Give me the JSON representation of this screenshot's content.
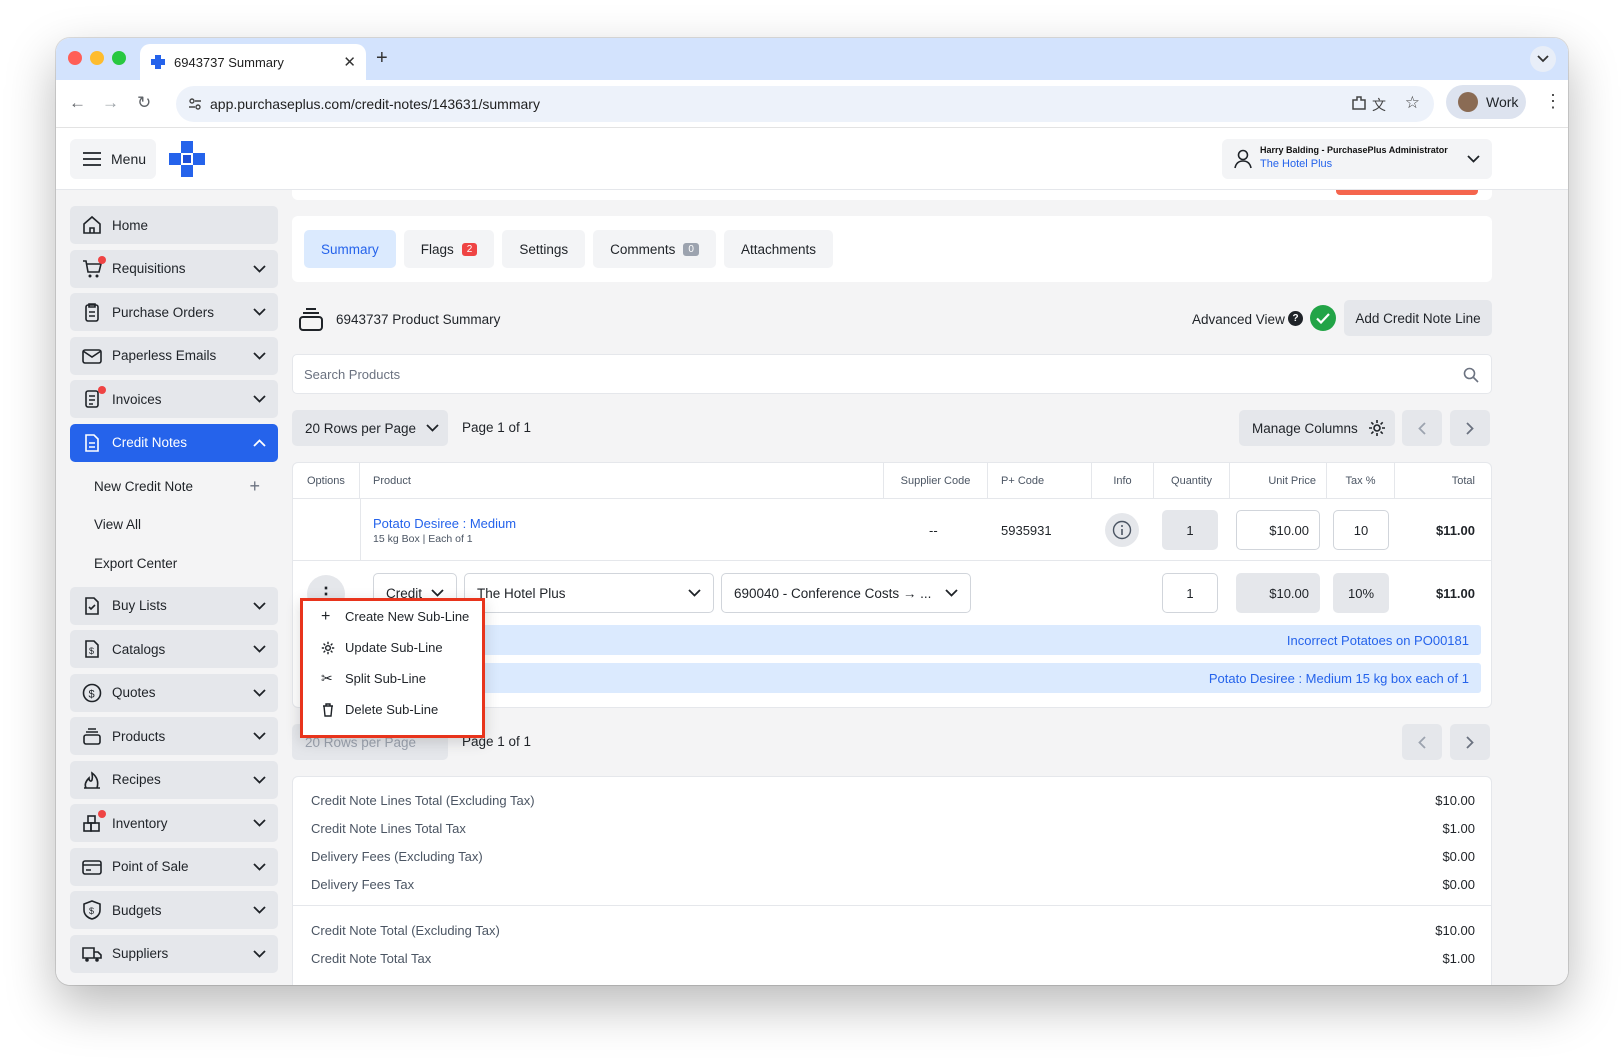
{
  "browser": {
    "tab_title": "6943737 Summary",
    "url": "app.purchaseplus.com/credit-notes/143631/summary",
    "profile_label": "Work"
  },
  "header": {
    "menu_label": "Menu",
    "user_name": "Harry Balding - PurchasePlus Administrator",
    "organisation": "The Hotel Plus"
  },
  "sidebar": {
    "items": [
      {
        "label": "Home"
      },
      {
        "label": "Requisitions"
      },
      {
        "label": "Purchase Orders"
      },
      {
        "label": "Paperless Emails"
      },
      {
        "label": "Invoices"
      },
      {
        "label": "Credit Notes"
      }
    ],
    "sub_items": [
      {
        "label": "New Credit Note"
      },
      {
        "label": "View All"
      },
      {
        "label": "Export Center"
      }
    ],
    "items_after": [
      {
        "label": "Buy Lists"
      },
      {
        "label": "Catalogs"
      },
      {
        "label": "Quotes"
      },
      {
        "label": "Products"
      },
      {
        "label": "Recipes"
      },
      {
        "label": "Inventory"
      },
      {
        "label": "Point of Sale"
      },
      {
        "label": "Budgets"
      },
      {
        "label": "Suppliers"
      }
    ]
  },
  "tabs": [
    {
      "label": "Summary"
    },
    {
      "label": "Flags",
      "count": "2"
    },
    {
      "label": "Settings"
    },
    {
      "label": "Comments",
      "count": "0"
    },
    {
      "label": "Attachments"
    }
  ],
  "summary": {
    "title": "6943737 Product Summary",
    "advanced_view_label": "Advanced View",
    "add_line_label": "Add Credit Note Line",
    "search_placeholder": "Search Products",
    "rows_per_page": "20 Rows per Page",
    "page_info": "Page 1 of 1",
    "manage_columns": "Manage Columns"
  },
  "table": {
    "headers": [
      "Options",
      "Product",
      "Supplier Code",
      "P+ Code",
      "Info",
      "Quantity",
      "Unit Price",
      "Tax %",
      "Total"
    ],
    "row": {
      "product_name": "Potato Desiree : Medium",
      "product_desc": "15 kg Box | Each of 1",
      "supplier_code": "--",
      "p_code": "5935931",
      "quantity": "1",
      "unit_price": "$10.00",
      "tax": "10",
      "total": "$11.00"
    },
    "subline": {
      "type": "Credit",
      "department": "The Hotel Plus",
      "account": "690040 - Conference Costs → ...",
      "quantity": "1",
      "unit_price": "$10.00",
      "tax": "10%",
      "total": "$11.00",
      "note1": "Incorrect Potatoes on PO00181",
      "note2": "Potato Desiree : Medium 15 kg box each of 1"
    }
  },
  "context_menu": [
    {
      "label": "Create New Sub-Line",
      "icon": "plus-icon"
    },
    {
      "label": "Update Sub-Line",
      "icon": "gear-icon"
    },
    {
      "label": "Split Sub-Line",
      "icon": "scissors-icon"
    },
    {
      "label": "Delete Sub-Line",
      "icon": "trash-icon"
    }
  ],
  "bottom_page_info": "Page 1 of 1",
  "totals": [
    {
      "label": "Credit Note Lines Total (Excluding Tax)",
      "value": "$10.00"
    },
    {
      "label": "Credit Note Lines Total Tax",
      "value": "$1.00"
    },
    {
      "label": "Delivery Fees (Excluding Tax)",
      "value": "$0.00"
    },
    {
      "label": "Delivery Fees Tax",
      "value": "$0.00"
    },
    {
      "label": "Credit Note Total (Excluding Tax)",
      "value": "$10.00"
    },
    {
      "label": "Credit Note Total Tax",
      "value": "$1.00"
    }
  ],
  "colors": {
    "accent": "#2563eb",
    "alert": "#ef4444",
    "highlight": "#e8341c",
    "success": "#22a447"
  }
}
